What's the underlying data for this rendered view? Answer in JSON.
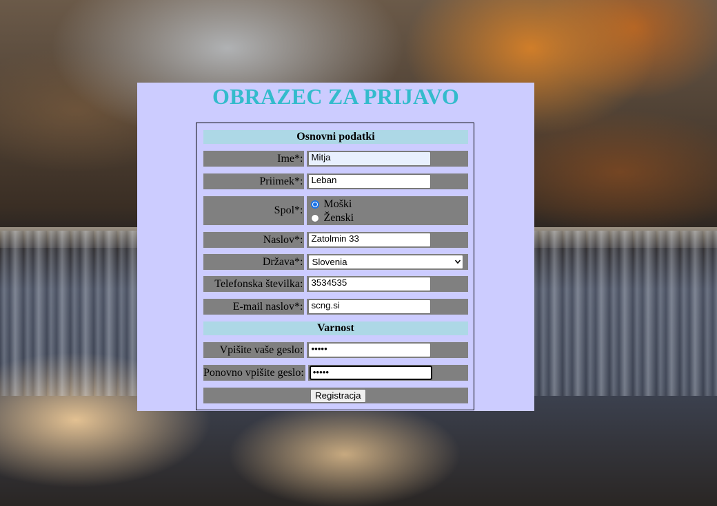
{
  "form": {
    "title": "OBRAZEC ZA PRIJAVO",
    "section_basic": "Osnovni podatki",
    "section_security": "Varnost",
    "fields": {
      "first_name": {
        "label": "Ime*:",
        "value": "Mitja"
      },
      "last_name": {
        "label": "Priimek*:",
        "value": "Leban"
      },
      "gender": {
        "label": "Spol*:",
        "options": [
          "Moški",
          "Ženski"
        ],
        "selected": "Moški"
      },
      "address": {
        "label": "Naslov*:",
        "value": "Zatolmin 33"
      },
      "country": {
        "label": "Država*:",
        "value": "Slovenia"
      },
      "phone": {
        "label": "Telefonska številka:",
        "value": "3534535"
      },
      "email": {
        "label": "E-mail naslov*:",
        "value": "scng.si"
      },
      "password": {
        "label": "Vpišite vaše geslo:",
        "value": "•••••"
      },
      "password_repeat": {
        "label": "Ponovno vpišite geslo:",
        "value": "•••••"
      }
    },
    "submit_label": "Registracja"
  },
  "colors": {
    "panel_bg": "#ccccff",
    "title": "#33bbcc",
    "section_bg": "#add8e6",
    "row_bg": "#808080",
    "radio_accent": "#1a73e8"
  }
}
